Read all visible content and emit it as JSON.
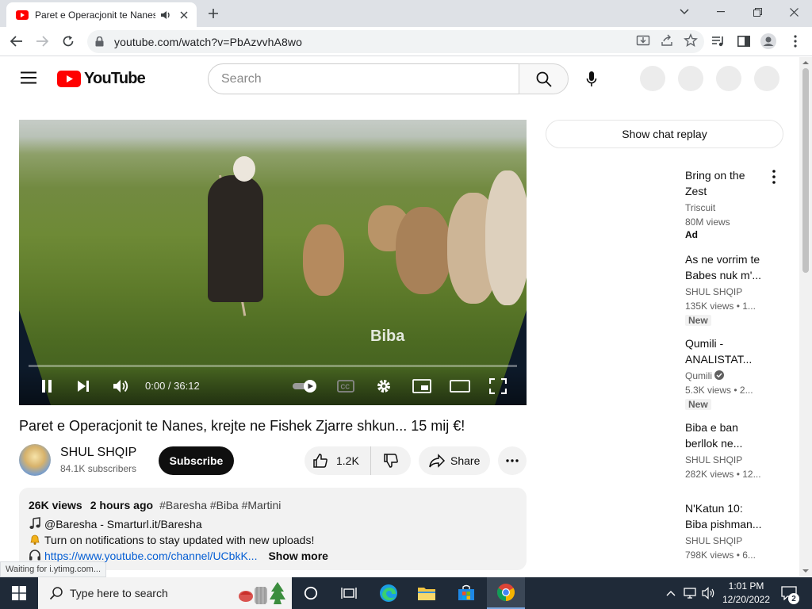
{
  "browser": {
    "tab_title": "Paret e Operacjonit te Nanes, kre",
    "url": "youtube.com/watch?v=PbAzvvhA8wo"
  },
  "youtube": {
    "logo_text": "YouTube",
    "search_placeholder": "Search",
    "player": {
      "watermark": "Biba",
      "time": "0:00 / 36:12",
      "progress": 0
    },
    "video": {
      "title": "Paret e Operacjonit te Nanes, krejte ne Fishek Zjarre shkun... 15 mij €!",
      "channel_name": "SHUL SHQIP",
      "subscribers": "84.1K subscribers",
      "subscribe_label": "Subscribe",
      "likes": "1.2K",
      "share_label": "Share"
    },
    "description": {
      "views": "26K views",
      "date": "2 hours ago",
      "tags": "#Baresha #Biba #Martini",
      "line1": "@Baresha - Smarturl.it/Baresha",
      "line2": "Turn on notifications to stay updated with new uploads!",
      "link": "https://www.youtube.com/channel/UCbkK...",
      "show_more": "Show more"
    },
    "chat_replay_label": "Show chat replay",
    "recommendations": [
      {
        "title_1": "Bring on the",
        "title_2": "Zest",
        "channel": "Triscuit",
        "meta": "80M views",
        "badge": "Ad"
      },
      {
        "title_1": "As ne vorrim te",
        "title_2": "Babes nuk m'...",
        "channel": "SHUL SHQIP",
        "meta": "135K views  • 1...",
        "badge": "New"
      },
      {
        "title_1": "Qumili -",
        "title_2": "ANALISTAT...",
        "channel": "Qumili",
        "meta": "5.3K views  • 2...",
        "badge": "New"
      },
      {
        "title_1": "Biba e ban",
        "title_2": "berllok ne...",
        "channel": "SHUL SHQIP",
        "meta": "282K views  • 12..."
      },
      {
        "title_1": "N'Katun 10:",
        "title_2": "Biba pishman...",
        "channel": "SHUL SHQIP",
        "meta": "798K views  • 6..."
      }
    ],
    "status_text": "Waiting for i.ytimg.com..."
  },
  "taskbar": {
    "search_placeholder": "Type here to search",
    "time": "1:01 PM",
    "date": "12/20/2022",
    "notification_count": "2"
  },
  "colors": {
    "yt_red": "#ff0000",
    "link_blue": "#065fd4",
    "taskbar_bg": "#1f2a38"
  }
}
